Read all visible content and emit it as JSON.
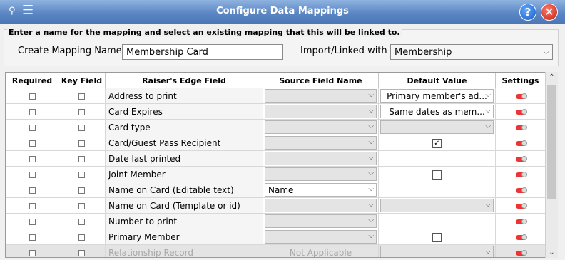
{
  "window": {
    "title": "Configure  Data Mappings"
  },
  "toolbar": {
    "pin_icon": "pin-icon",
    "menu_icon": "list-menu-icon",
    "help_label": "?",
    "close_label": "✕"
  },
  "form": {
    "instructions": "Enter a name for the mapping and select an existing mapping that this will be linked to.",
    "mapping_name_label": "Create Mapping Name",
    "mapping_name_value": "Membership Card",
    "linked_label": "Import/Linked with",
    "linked_value": "Membership"
  },
  "table": {
    "headers": [
      "Required",
      "Key Field",
      "Raiser's Edge Field",
      "Source Field Name",
      "Default Value",
      "Settings"
    ],
    "rows": [
      {
        "field": "Address to print",
        "source": "",
        "default_type": "dropdown",
        "default_value": "Primary member's ad..."
      },
      {
        "field": "Card Expires",
        "source": "",
        "default_type": "dropdown",
        "default_value": "Same dates as mem..."
      },
      {
        "field": "Card type",
        "source": "",
        "default_type": "dropdown",
        "default_value": ""
      },
      {
        "field": "Card/Guest Pass Recipient",
        "source": "",
        "default_type": "checkbox",
        "default_value": "✓"
      },
      {
        "field": "Date last printed",
        "source": "",
        "default_type": "none",
        "default_value": ""
      },
      {
        "field": "Joint Member",
        "source": "",
        "default_type": "checkbox",
        "default_value": ""
      },
      {
        "field": "Name on Card (Editable text)",
        "source": "Name",
        "default_type": "none",
        "default_value": ""
      },
      {
        "field": "Name on Card (Template or id)",
        "source": "",
        "default_type": "dropdown",
        "default_value": ""
      },
      {
        "field": "Number to print",
        "source": "",
        "default_type": "none",
        "default_value": ""
      },
      {
        "field": "Primary Member",
        "source": "",
        "default_type": "checkbox",
        "default_value": ""
      },
      {
        "field": "Relationship Record",
        "source": "Not Applicable",
        "default_type": "dropdown",
        "default_value": "",
        "disabled": true
      }
    ]
  },
  "colors": {
    "titlebar": "#5b86c4",
    "toggle": "#e33333"
  }
}
